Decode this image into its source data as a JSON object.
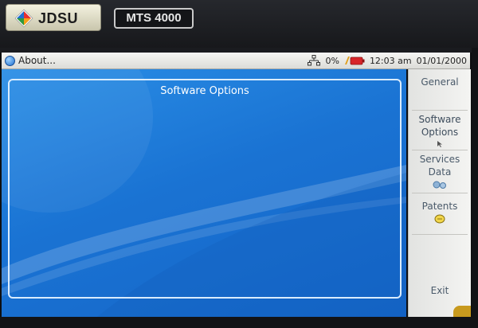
{
  "device": {
    "brand": "JDSU",
    "model": "MTS 4000"
  },
  "titlebar": {
    "title": "About...",
    "battery_percent": "0%",
    "time": "12:03 am",
    "date": "01/01/2000"
  },
  "icons": {
    "about": "info-icon",
    "network": "network-icon",
    "battery": "battery-icon"
  },
  "content": {
    "panel_title": "Software Options"
  },
  "sidemenu": {
    "items": [
      {
        "label": "General"
      },
      {
        "label": "Software Options"
      },
      {
        "label": "Services Data"
      },
      {
        "label": "Patents"
      },
      {
        "label": "Exit"
      }
    ]
  },
  "colors": {
    "content_blue": "#1a73d3",
    "menu_text": "#4a5a6a"
  }
}
